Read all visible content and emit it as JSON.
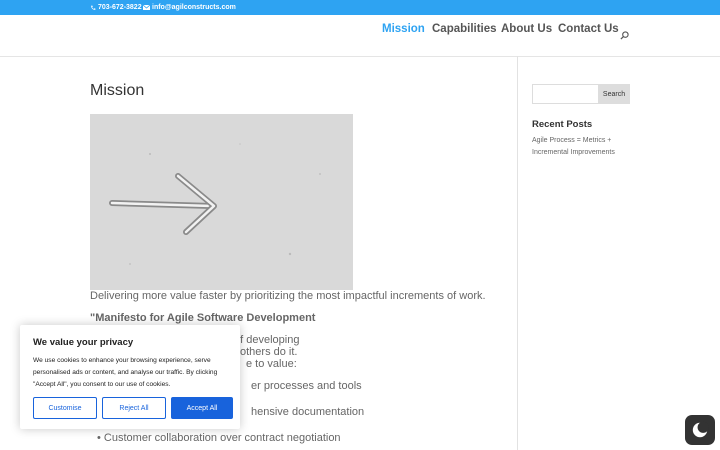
{
  "topbar": {
    "phone": "703-672-3822",
    "email": "info@agilconstructs.com"
  },
  "nav": {
    "items": [
      {
        "label": "Mission"
      },
      {
        "label": "Capabilities"
      },
      {
        "label": "About Us"
      },
      {
        "label": "Contact Us"
      }
    ]
  },
  "main": {
    "title": "Mission",
    "intro": "Delivering more value faster by prioritizing the most impactful increments of work.",
    "manifesto_title": "\"Manifesto for Agile Software Development",
    "line1": "of developing",
    "line2": "others do it.",
    "line3": "e to value:",
    "bullet1": "er processes and tools",
    "bullet2": "hensive documentation",
    "bullet3": "Customer collaboration over contract negotiation"
  },
  "sidebar": {
    "search_button": "Search",
    "recent_title": "Recent Posts",
    "recent_link": "Agile Process = Metrics + Incremental Improvements"
  },
  "cookie": {
    "title": "We value your privacy",
    "body": "We use cookies to enhance your browsing experience, serve personalised ads or content, and analyse our traffic. By clicking \"Accept All\", you consent to our use of cookies.",
    "customise": "Customise",
    "reject": "Reject All",
    "accept": "Accept All"
  },
  "colors": {
    "accent": "#2ea3f2",
    "cookie_button": "#1863dc"
  }
}
